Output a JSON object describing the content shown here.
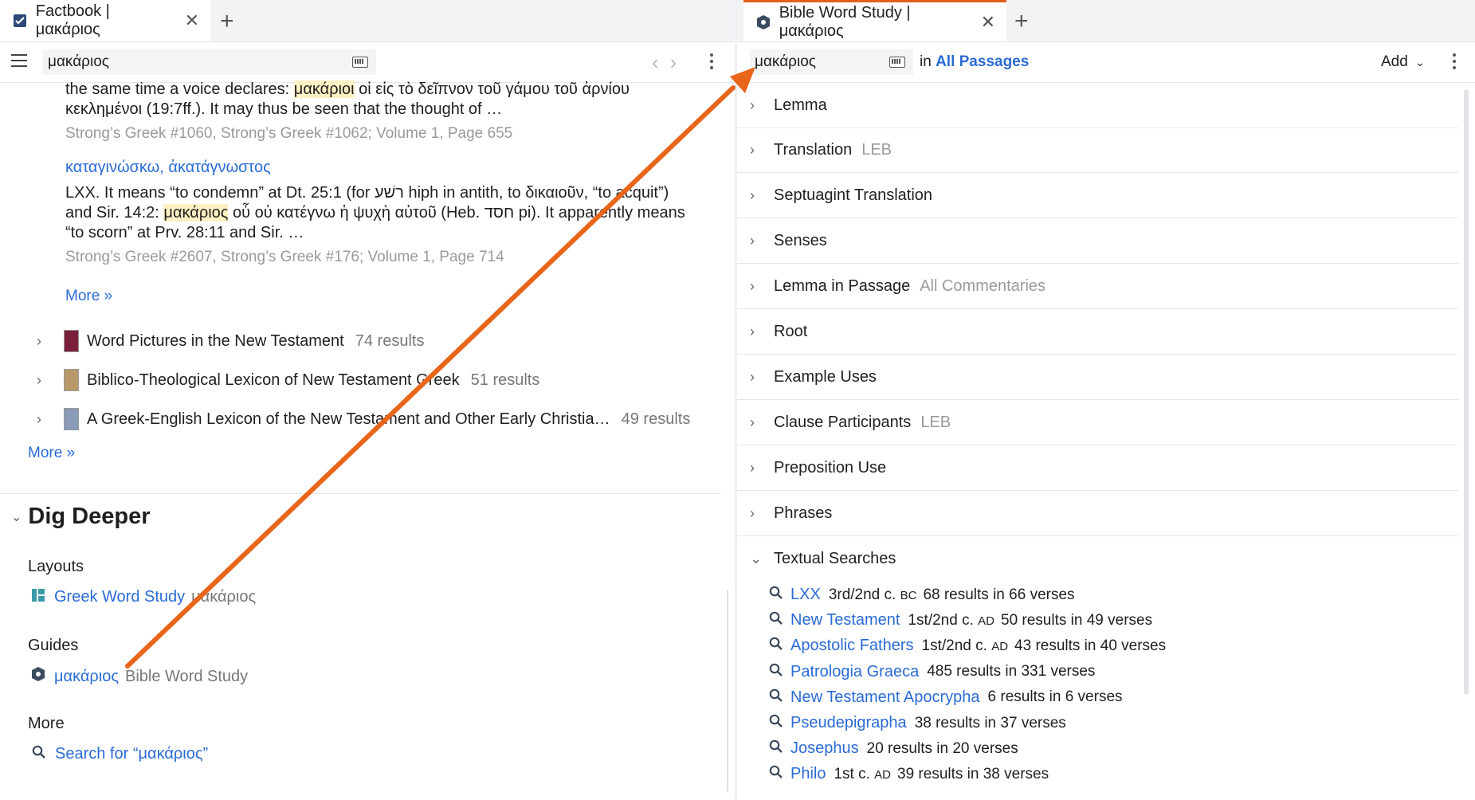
{
  "left": {
    "tab_title": "Factbook | μακάριος",
    "search_value": "μακάριος",
    "para1_line1_pre": "the same time a voice declares: ",
    "para1_hl": "μακάριοι",
    "para1_line1_post": " οἱ εἰς τὸ δεῖπνον τοῦ γάμου τοῦ ἀρνίου",
    "para1_line2": "κεκλημένοι (19:7ff.). It may thus be seen that the thought of …",
    "src1": "Strong’s Greek #1060, Strong’s Greek #1062; Volume 1, Page 655",
    "entry2_title": "καταγινώσκω, ἀκατάγνωστος",
    "para2_line1": "LXX. It means “to condemn” at Dt. 25:1 (for רשׁע hiph in antith, to δικαιοῦν, “to acquit”)",
    "para2_line2_pre": "and Sir. 14:2: ",
    "para2_hl": "μακάριος",
    "para2_line2_post": " οὗ οὐ κατέγνω ἡ ψυχὴ αὐτοῦ (Heb. חסד pi). It apparently means",
    "para2_line3": "“to scorn” at Prv. 28:11 and Sir. …",
    "src2": "Strong’s Greek #2607, Strong’s Greek #176; Volume 1, Page 714",
    "more_inner": "More »",
    "results": [
      {
        "title": "Word Pictures in the New Testament",
        "count": "74 results",
        "color": "#7a1f3a"
      },
      {
        "title": "Biblico-Theological Lexicon of New Testament Greek",
        "count": "51 results",
        "color": "#b89a6a"
      },
      {
        "title": "A Greek-English Lexicon of the New Testament and Other Early Christia…",
        "count": "49 results",
        "color": "#8a9bb8"
      }
    ],
    "more_outer": "More »",
    "dig_deeper": "Dig Deeper",
    "layouts_label": "Layouts",
    "layout_link": "Greek Word Study",
    "layout_term": "μακάριος",
    "guides_label": "Guides",
    "guide_link": "μακάριος",
    "guide_name": "Bible Word Study",
    "more_label": "More",
    "search_for": "Search for “μακάριος”"
  },
  "right": {
    "tab_title": "Bible Word Study | μακάριος",
    "search_value": "μακάριος",
    "in_label": "in",
    "passages_link": "All Passages",
    "add_label": "Add",
    "sections": [
      {
        "label": "Lemma",
        "aux": ""
      },
      {
        "label": "Translation",
        "aux": "LEB"
      },
      {
        "label": "Septuagint Translation",
        "aux": ""
      },
      {
        "label": "Senses",
        "aux": ""
      },
      {
        "label": "Lemma in Passage",
        "aux": "All Commentaries"
      },
      {
        "label": "Root",
        "aux": ""
      },
      {
        "label": "Example Uses",
        "aux": ""
      },
      {
        "label": "Clause Participants",
        "aux": "LEB"
      },
      {
        "label": "Preposition Use",
        "aux": ""
      },
      {
        "label": "Phrases",
        "aux": ""
      },
      {
        "label": "Textual Searches",
        "aux": ""
      }
    ],
    "textual": [
      {
        "name": "LXX",
        "era": "3rd/2nd c.",
        "era_sc": "BC",
        "res": "68 results in 66 verses"
      },
      {
        "name": "New Testament",
        "era": "1st/2nd c.",
        "era_sc": "AD",
        "res": "50 results in 49 verses"
      },
      {
        "name": "Apostolic Fathers",
        "era": "1st/2nd c.",
        "era_sc": "AD",
        "res": "43 results in 40 verses"
      },
      {
        "name": "Patrologia Graeca",
        "era": "",
        "era_sc": "",
        "res": "485 results in 331 verses"
      },
      {
        "name": "New Testament Apocrypha",
        "era": "",
        "era_sc": "",
        "res": "6 results in 6 verses"
      },
      {
        "name": "Pseudepigrapha",
        "era": "",
        "era_sc": "",
        "res": "38 results in 37 verses"
      },
      {
        "name": "Josephus",
        "era": "",
        "era_sc": "",
        "res": "20 results in 20 verses"
      },
      {
        "name": "Philo",
        "era": "1st c.",
        "era_sc": "AD",
        "res": "39 results in 38 verses"
      }
    ]
  },
  "colors": {
    "accent": "#e3601a",
    "link": "#2a6bd6",
    "highlight": "#fdf0c2"
  }
}
